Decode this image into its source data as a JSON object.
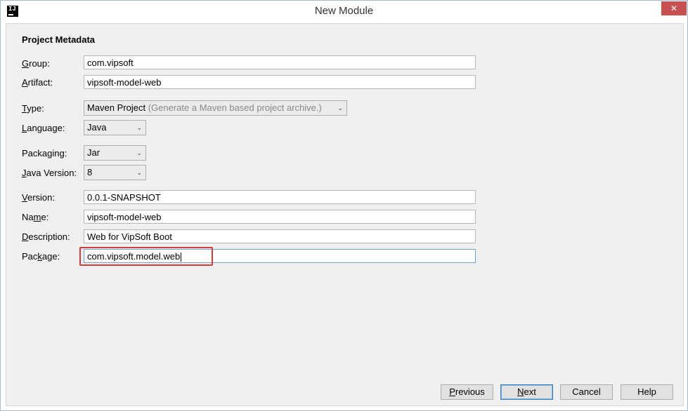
{
  "window": {
    "title": "New Module"
  },
  "section": {
    "title": "Project Metadata"
  },
  "fields": {
    "group": {
      "mn": "G",
      "rest": "roup:",
      "value": "com.vipsoft"
    },
    "artifact": {
      "mn": "A",
      "rest": "rtifact:",
      "value": "vipsoft-model-web"
    },
    "type": {
      "mn": "T",
      "rest": "ype:",
      "value": "Maven Project",
      "hint": "(Generate a Maven based project archive.)"
    },
    "language": {
      "mn": "L",
      "rest": "anguage:",
      "value": "Java"
    },
    "packaging": {
      "pre": "Packa",
      "mn": "g",
      "rest": "ing:",
      "value": "Jar"
    },
    "java_version": {
      "mn": "J",
      "rest": "ava Version:",
      "value": "8"
    },
    "version": {
      "mn": "V",
      "rest": "ersion:",
      "value": "0.0.1-SNAPSHOT"
    },
    "name": {
      "pre": "Na",
      "mn": "m",
      "rest": "e:",
      "value": "vipsoft-model-web"
    },
    "description": {
      "mn": "D",
      "rest": "escription:",
      "value": "Web for VipSoft Boot"
    },
    "package": {
      "pre": "Pac",
      "mn": "k",
      "rest": "age:",
      "value": "com.vipsoft.model.web"
    }
  },
  "buttons": {
    "previous": {
      "mn": "P",
      "rest": "revious"
    },
    "next": {
      "mn": "N",
      "rest": "ext"
    },
    "cancel": "Cancel",
    "help": "Help"
  },
  "icons": {
    "app": "intellij-icon",
    "close": "close-icon",
    "dropdown": "chevron-down-icon"
  },
  "colors": {
    "highlight": "#d43b3b",
    "close_bg": "#c75050",
    "focus": "#6aa7d6"
  }
}
